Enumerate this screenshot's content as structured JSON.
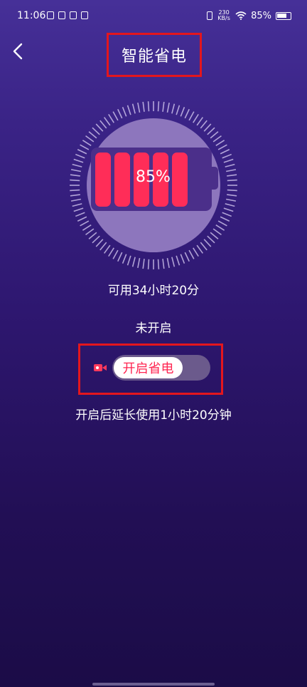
{
  "status_bar": {
    "time": "11:06",
    "net_speed_value": "230",
    "net_speed_unit": "KB/s",
    "battery_percent": "85%",
    "left_icons": [
      "notification-icon",
      "app-icon",
      "tiktok-icon",
      "app-icon"
    ],
    "right_icons": [
      "vibrate-icon",
      "wifi-icon",
      "battery-icon"
    ]
  },
  "header": {
    "title": "智能省电",
    "back_icon": "chevron-left-icon"
  },
  "battery": {
    "percent_label": "85%",
    "level": 0.85,
    "cell_color": "#ff2d58"
  },
  "info": {
    "remaining": "可用34小时20分",
    "mode_status": "未开启"
  },
  "toggle": {
    "label": "开启省电",
    "icon": "video-icon",
    "on": false
  },
  "footer": {
    "extend_note": "开启后延长使用1小时20分钟"
  },
  "colors": {
    "highlight_border": "#e4161d",
    "accent": "#ff2450"
  }
}
